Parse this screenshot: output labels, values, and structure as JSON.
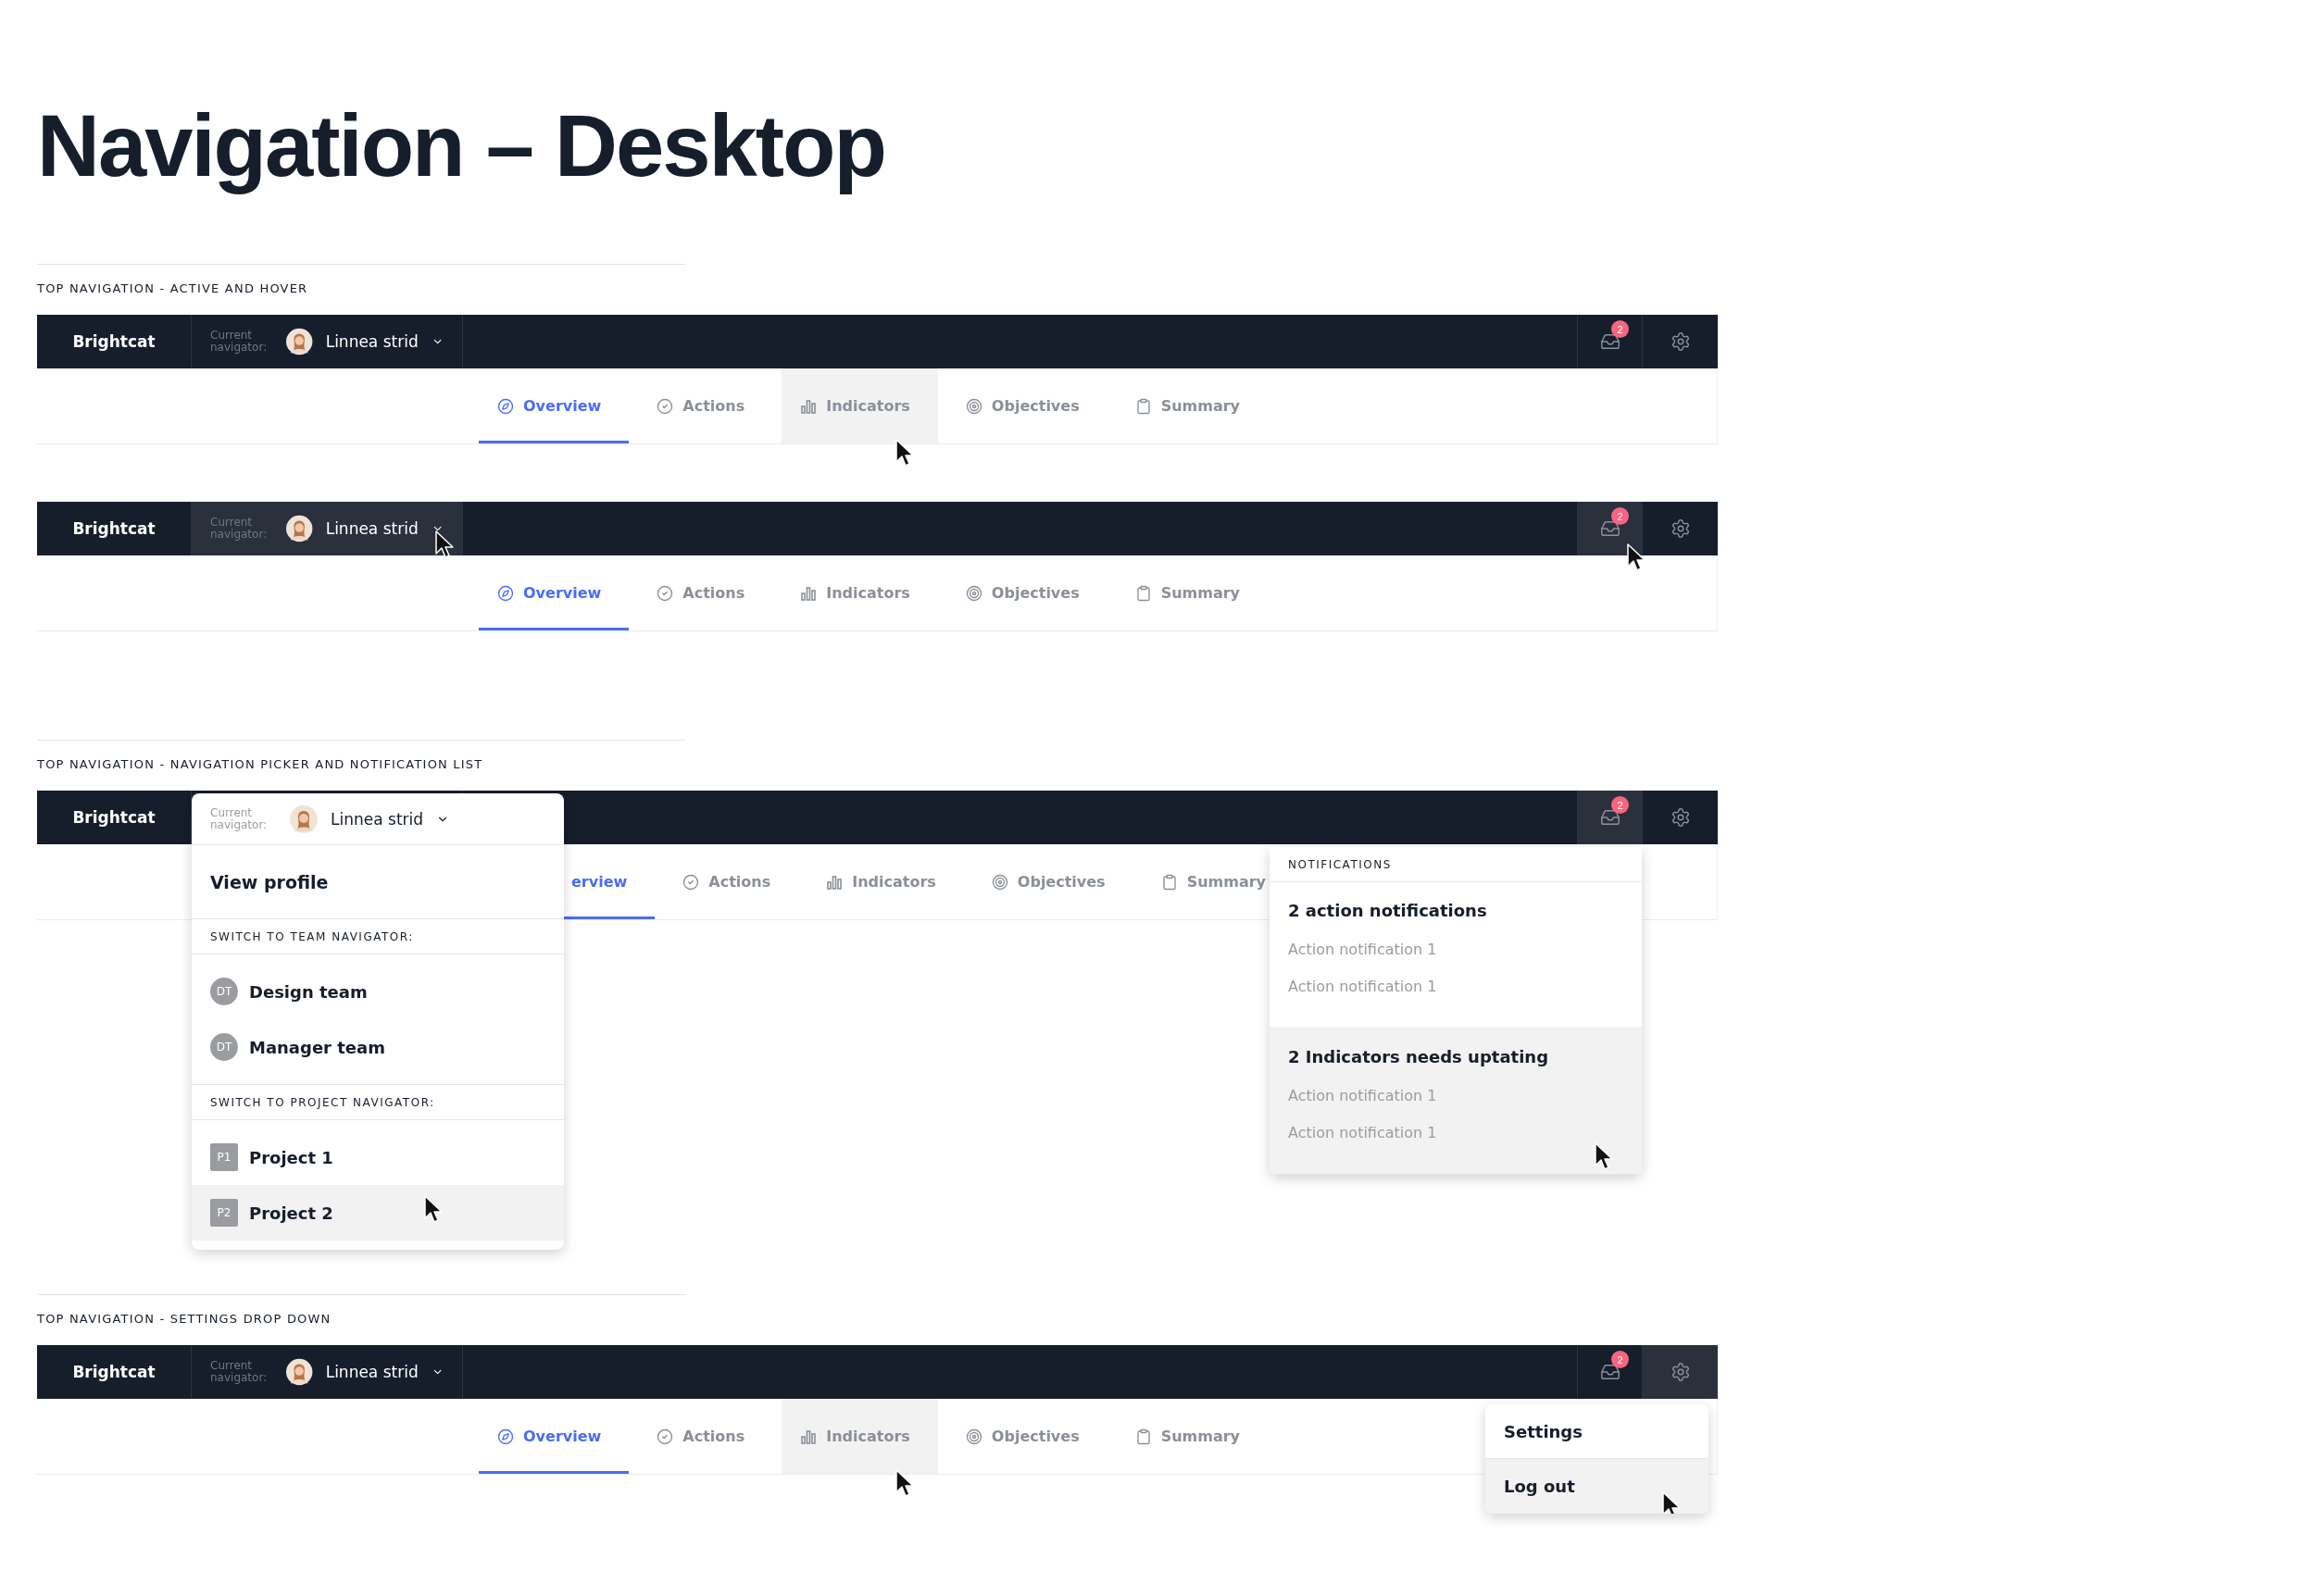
{
  "title": "Navigation – Desktop",
  "sections": [
    {
      "label": "TOP NAVIGATION - ACTIVE AND HOVER",
      "frames": [
        {
          "navbar": {
            "brand": "Brightcat",
            "navigator_label": "Current navigator:",
            "user": "Linnea strid",
            "picker_hovered": false,
            "inbox_badge": "2",
            "inbox_hovered": false,
            "settings_hovered": false
          },
          "tabs": [
            {
              "label": "Overview",
              "selected": true,
              "hovered": false
            },
            {
              "label": "Actions",
              "selected": false,
              "hovered": false
            },
            {
              "label": "Indicators",
              "selected": false,
              "hovered": true
            },
            {
              "label": "Objectives",
              "selected": false,
              "hovered": false
            },
            {
              "label": "Summary",
              "selected": false,
              "hovered": false
            }
          ]
        },
        {
          "navbar": {
            "brand": "Brightcat",
            "navigator_label": "Current navigator:",
            "user": "Linnea strid",
            "picker_hovered": true,
            "inbox_badge": "2",
            "inbox_hovered": true,
            "settings_hovered": false
          },
          "tabs": [
            {
              "label": "Overview",
              "selected": true,
              "hovered": false
            },
            {
              "label": "Actions",
              "selected": false,
              "hovered": false
            },
            {
              "label": "Indicators",
              "selected": false,
              "hovered": false
            },
            {
              "label": "Objectives",
              "selected": false,
              "hovered": false
            },
            {
              "label": "Summary",
              "selected": false,
              "hovered": false
            }
          ]
        }
      ]
    },
    {
      "label": "TOP NAVIGATION - NAVIGATION PICKER AND NOTIFICATION LIST",
      "frames": [
        {
          "navbar": {
            "brand": "Brightcat",
            "picker_hovered": false,
            "inbox_badge": "2",
            "inbox_hovered": false,
            "settings_hovered": false
          },
          "tabs": [
            {
              "label": "erview",
              "kind": "clipped",
              "selected": true,
              "hovered": false
            },
            {
              "label": "Actions",
              "selected": false,
              "hovered": false
            },
            {
              "label": "Indicators",
              "selected": false,
              "hovered": false
            },
            {
              "label": "Objectives",
              "selected": false,
              "hovered": false
            },
            {
              "label": "Summary",
              "selected": false,
              "hovered": false
            }
          ],
          "picker_menu": {
            "navigator_label": "Current navigator:",
            "user": "Linnea strid",
            "view_profile": "View profile",
            "groups": [
              {
                "heading": "SWITCH TO TEAM NAVIGATOR:",
                "kind": "team",
                "items": [
                  {
                    "initials": "DT",
                    "name": "Design team",
                    "hovered": false
                  },
                  {
                    "initials": "DT",
                    "name": "Manager team",
                    "hovered": false
                  }
                ]
              },
              {
                "heading": "SWITCH TO PROJECT NAVIGATOR:",
                "kind": "project",
                "items": [
                  {
                    "initials": "P1",
                    "name": "Project 1",
                    "hovered": false
                  },
                  {
                    "initials": "P2",
                    "name": "Project 2",
                    "hovered": true
                  }
                ]
              }
            ]
          },
          "notifications": {
            "heading": "NOTIFICATIONS",
            "groups": [
              {
                "title": "2 action notifications",
                "hovered": false,
                "items": [
                  "Action notification 1",
                  "Action notification 1"
                ]
              },
              {
                "title": "2 Indicators needs uptating",
                "hovered": true,
                "items": [
                  "Action notification 1",
                  "Action notification 1"
                ]
              }
            ]
          }
        }
      ]
    },
    {
      "label": "TOP NAVIGATION - SETTINGS DROP DOWN",
      "frames": [
        {
          "navbar": {
            "brand": "Brightcat",
            "navigator_label": "Current navigator:",
            "user": "Linnea strid",
            "picker_hovered": false,
            "inbox_badge": "2",
            "inbox_hovered": false,
            "settings_hovered": false
          },
          "tabs": [
            {
              "label": "Overview",
              "selected": true,
              "hovered": false
            },
            {
              "label": "Actions",
              "selected": false,
              "hovered": false
            },
            {
              "label": "Indicators",
              "selected": false,
              "hovered": true
            },
            {
              "label": "Objectives",
              "selected": false,
              "hovered": false
            },
            {
              "label": "Summary",
              "selected": false,
              "hovered": false
            }
          ],
          "settings_menu": {
            "items": [
              {
                "label": "Settings",
                "hovered": false
              },
              {
                "label": "Log out",
                "hovered": true
              }
            ]
          }
        }
      ]
    }
  ]
}
